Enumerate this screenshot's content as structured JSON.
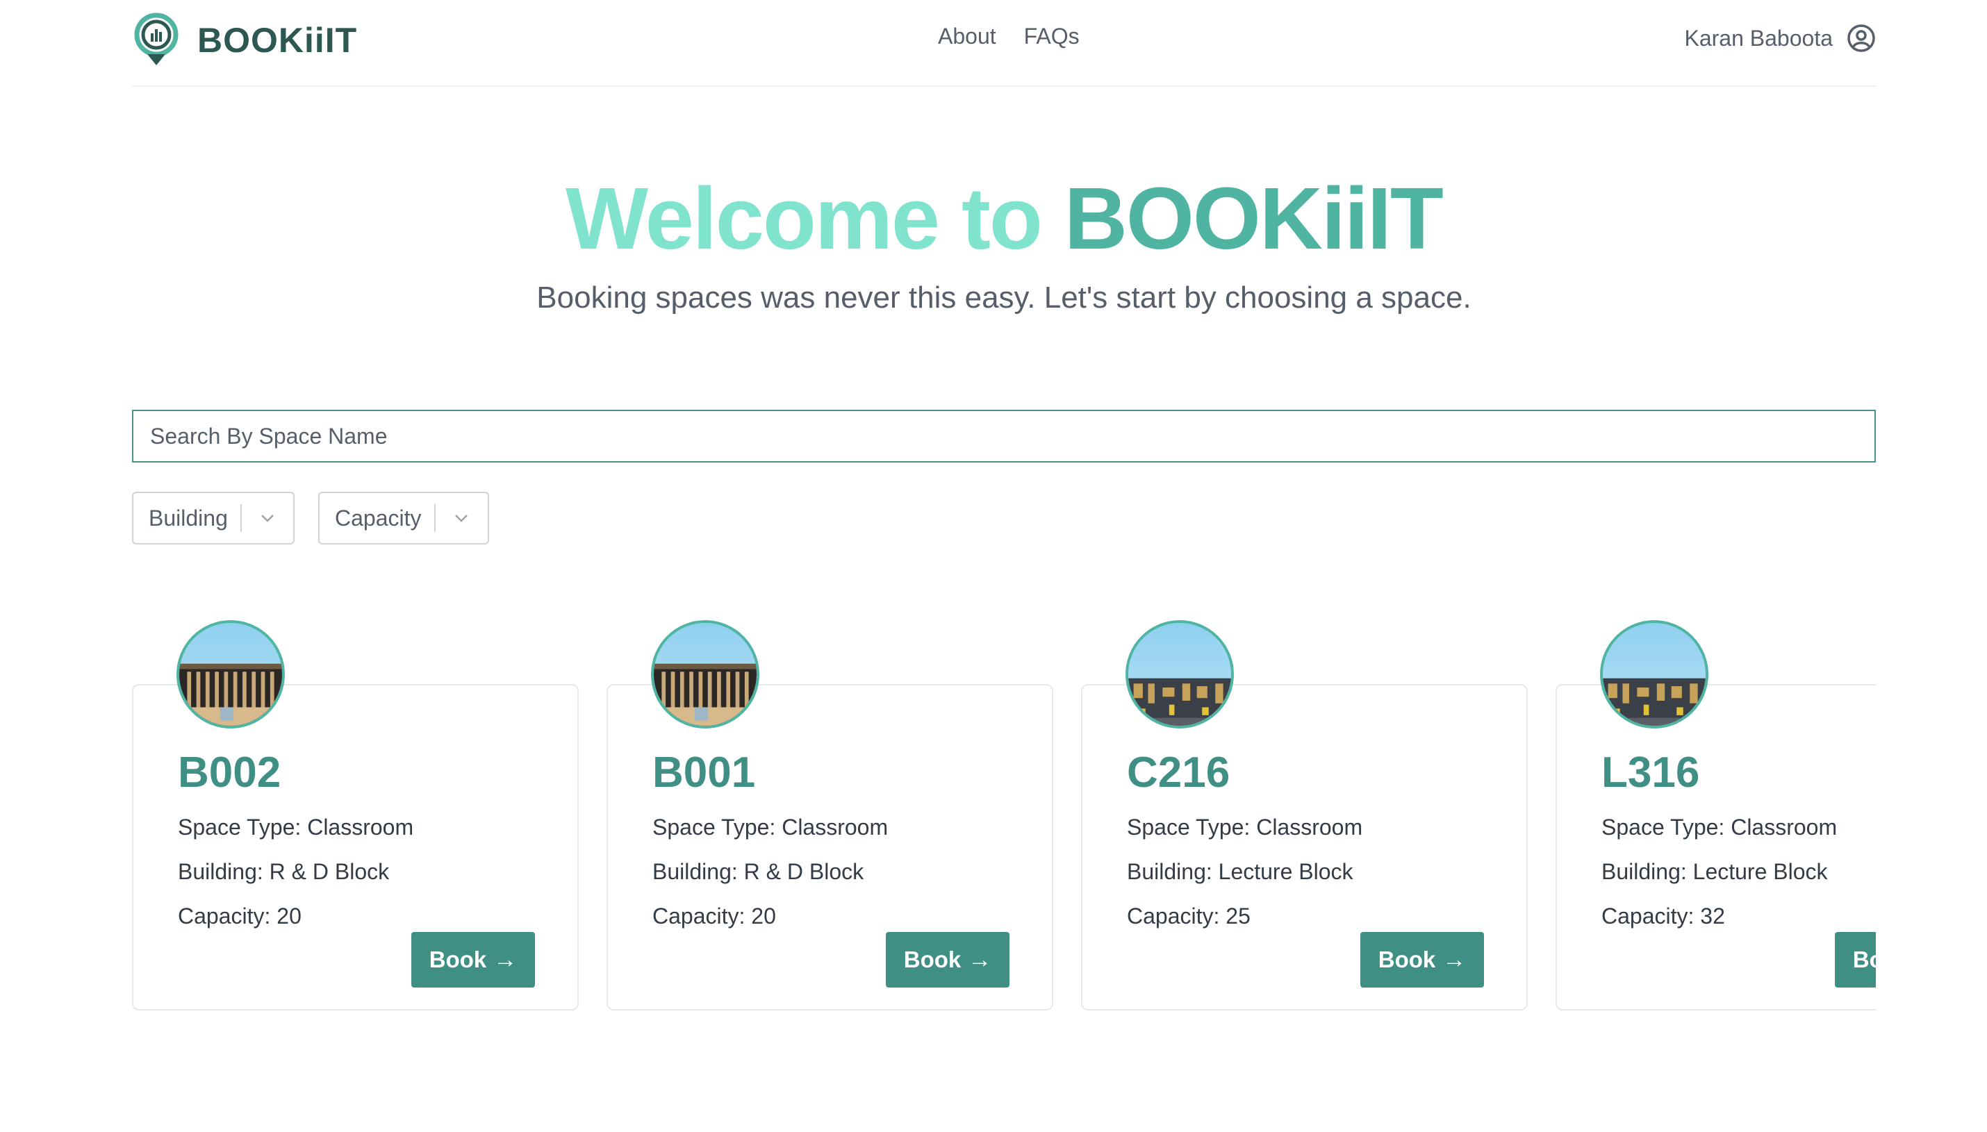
{
  "header": {
    "logo_text": "BOOKiiIT",
    "nav": [
      "About",
      "FAQs"
    ],
    "user_name": "Karan Baboota"
  },
  "hero": {
    "title_part1": "Welcome to ",
    "title_part2": "BOOKiiIT",
    "subtitle": "Booking spaces was never this easy. Let's start by choosing a space."
  },
  "search": {
    "placeholder": "Search By Space Name",
    "value": ""
  },
  "filters": [
    {
      "label": "Building"
    },
    {
      "label": "Capacity"
    }
  ],
  "spaces": [
    {
      "name": "B002",
      "type": "Space Type: Classroom",
      "building": "Building: R & D Block",
      "capacity": "Capacity: 20",
      "button": "Book",
      "image": "rd-block-building"
    },
    {
      "name": "B001",
      "type": "Space Type: Classroom",
      "building": "Building: R & D Block",
      "capacity": "Capacity: 20",
      "button": "Book",
      "image": "rd-block-building"
    },
    {
      "name": "C216",
      "type": "Space Type: Classroom",
      "building": "Building: Lecture Block",
      "capacity": "Capacity: 25",
      "button": "Book",
      "image": "lecture-block-building"
    },
    {
      "name": "L316",
      "type": "Space Type: Classroom",
      "building": "Building: Lecture Block",
      "capacity": "Capacity: 32",
      "button": "Book",
      "image": "lecture-block-building"
    }
  ],
  "colors": {
    "accent": "#3f8f84",
    "title_light": "#7fe3cd",
    "title_dark": "#4fb5a2"
  }
}
